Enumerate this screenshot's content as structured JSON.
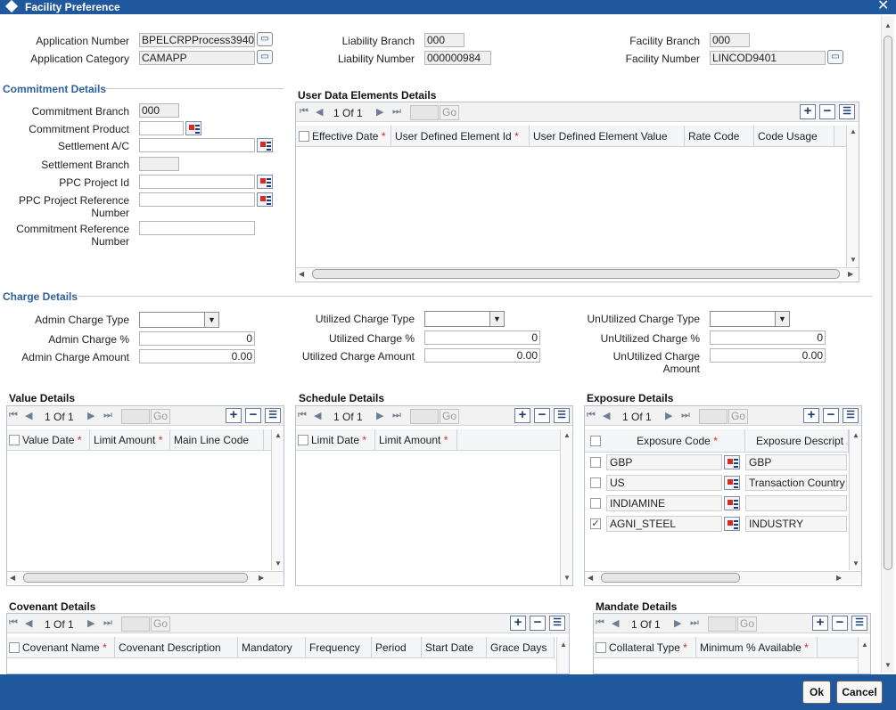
{
  "window": {
    "title": "Facility Preference",
    "close_glyph": "✕"
  },
  "header": {
    "application_number_label": "Application Number",
    "application_number": "BPELCRPProcess3940",
    "application_category_label": "Application Category",
    "application_category": "CAMAPP",
    "liability_branch_label": "Liability Branch",
    "liability_branch": "000",
    "liability_number_label": "Liability Number",
    "liability_number": "000000984",
    "facility_branch_label": "Facility Branch",
    "facility_branch": "000",
    "facility_number_label": "Facility Number",
    "facility_number": "LINCOD9401"
  },
  "commitment": {
    "title": "Commitment Details",
    "branch_label": "Commitment Branch",
    "branch": "000",
    "product_label": "Commitment Product",
    "settlement_ac_label": "Settlement A/C",
    "settlement_branch_label": "Settlement Branch",
    "ppc_project_id_label": "PPC Project Id",
    "ppc_project_ref_label": "PPC Project Reference Number",
    "commitment_ref_label": "Commitment Reference Number"
  },
  "user_data": {
    "title": "User Data Elements Details",
    "pager": "1 Of 1",
    "go": "Go",
    "columns": [
      "Effective Date",
      "User Defined Element Id",
      "User Defined Element Value",
      "Rate Code",
      "Code Usage"
    ]
  },
  "charge": {
    "title": "Charge Details",
    "admin_type_label": "Admin Charge Type",
    "admin_pct_label": "Admin Charge %",
    "admin_pct": "0",
    "admin_amt_label": "Admin Charge Amount",
    "admin_amt": "0.00",
    "util_type_label": "Utilized Charge Type",
    "util_pct_label": "Utilized Charge %",
    "util_pct": "0",
    "util_amt_label": "Utilized Charge Amount",
    "util_amt": "0.00",
    "unutil_type_label": "UnUtilized Charge Type",
    "unutil_pct_label": "UnUtilized Charge %",
    "unutil_pct": "0",
    "unutil_amt_label": "UnUtilized Charge Amount",
    "unutil_amt": "0.00"
  },
  "value_details": {
    "title": "Value Details",
    "pager": "1 Of 1",
    "go": "Go",
    "columns": [
      "Value Date",
      "Limit Amount",
      "Main Line Code"
    ]
  },
  "schedule_details": {
    "title": "Schedule Details",
    "pager": "1 Of 1",
    "go": "Go",
    "columns": [
      "Limit Date",
      "Limit Amount"
    ]
  },
  "exposure_details": {
    "title": "Exposure Details",
    "pager": "1 Of 1",
    "go": "Go",
    "columns": [
      "Exposure Code",
      "Exposure Descript"
    ],
    "rows": [
      {
        "code": "GBP",
        "desc": "GBP",
        "checked": false
      },
      {
        "code": "US",
        "desc": "Transaction Country",
        "checked": false
      },
      {
        "code": "INDIAMINE",
        "desc": "",
        "checked": false
      },
      {
        "code": "AGNI_STEEL",
        "desc": "INDUSTRY",
        "checked": true
      }
    ]
  },
  "covenant_details": {
    "title": "Covenant Details",
    "pager": "1 Of 1",
    "go": "Go",
    "columns": [
      "Covenant Name",
      "Covenant Description",
      "Mandatory",
      "Frequency",
      "Period",
      "Start Date",
      "Grace Days"
    ]
  },
  "mandate_details": {
    "title": "Mandate Details",
    "pager": "1 Of 1",
    "go": "Go",
    "columns": [
      "Collateral Type",
      "Minimum % Available"
    ]
  },
  "footer": {
    "ok": "Ok",
    "cancel": "Cancel"
  },
  "colors": {
    "titlebar": "#20589e",
    "section": "#2f5f9d"
  }
}
